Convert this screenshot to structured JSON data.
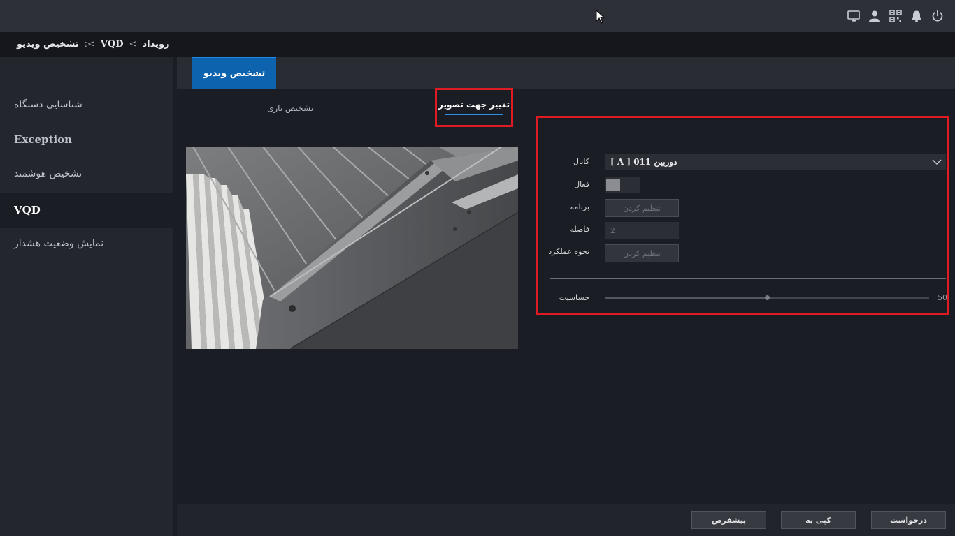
{
  "breadcrumb": {
    "root": "رویداد",
    "sep1": ">",
    "mid": "VQD",
    "sep2": ">:",
    "current": "تشخیص ویدیو"
  },
  "sidebar": {
    "items": [
      {
        "label": "شناسایی دستگاه",
        "active": false
      },
      {
        "label": "Exception",
        "active": false
      },
      {
        "label": "تشخیص هوشمند",
        "active": false
      },
      {
        "label": "VQD",
        "active": true
      },
      {
        "label": "نمایش وضعیت هشدار",
        "active": false
      }
    ]
  },
  "main_tab": {
    "label": "تشخیص ویدیو"
  },
  "subtabs": {
    "active": "تغییر جهت تصویر",
    "other": "تشخیص تاری"
  },
  "form": {
    "channel_label": "کانال",
    "channel_value": "[ A ] 01دوربین 1",
    "enable_label": "فعال",
    "enable_checked": true,
    "schedule_label": "برنامه",
    "schedule_button": "تنظیم کردن",
    "interval_label": "فاصله",
    "interval_value": "2",
    "action_label": "نحوه عملکرد",
    "action_button": "تنظیم کردن",
    "sensitivity_label": "حساسیت",
    "sensitivity_value": "50",
    "sensitivity_fraction": 0.5
  },
  "footer": {
    "default_button": "پیشفرض",
    "copy_button": "کپی به",
    "apply_button": "درخواست"
  },
  "colors": {
    "accent": "#0d63ad",
    "highlight_box": "#e01b24"
  },
  "icons": [
    "monitor-icon",
    "user-icon",
    "qr-code-icon",
    "alarm-bell-icon",
    "power-icon"
  ]
}
